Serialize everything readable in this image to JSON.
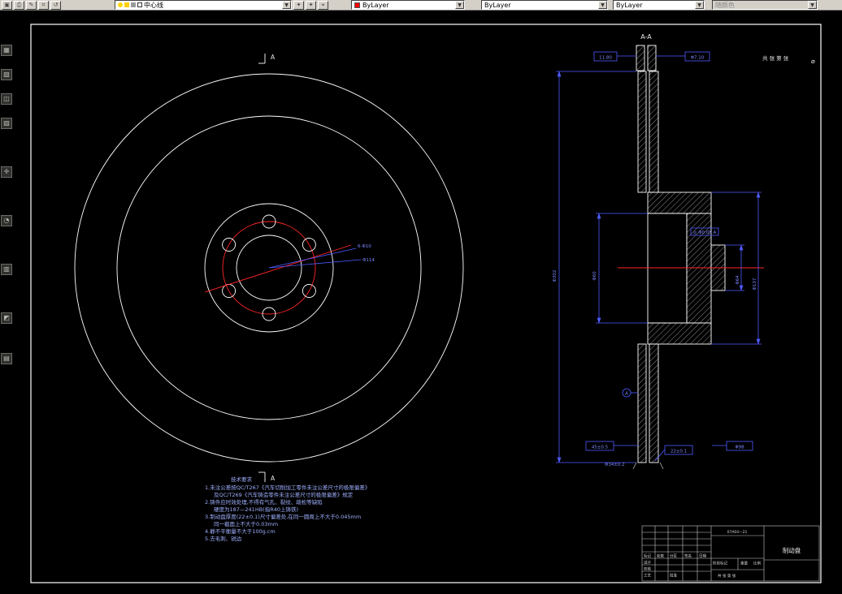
{
  "toolbar": {
    "icons_left": [
      "▣",
      "⎙",
      "✎",
      "⌗",
      "↺"
    ],
    "icons_mid": [
      "✦",
      "✦",
      "⌖"
    ],
    "layer_name": "中心线",
    "color_value": "ByLayer",
    "linetype_value": "ByLayer",
    "lineweight_value": "ByLayer",
    "plot_style_value": "随颜色"
  },
  "icons": {
    "dropdown": "▼"
  },
  "side_tools": [
    "▦",
    "▧",
    "◫",
    "▨",
    "✛",
    "◔",
    "▥",
    "◩",
    "▤"
  ],
  "sheet": {
    "top_note": "共 张 第 张",
    "top_symbol": "⌀"
  },
  "front_view": {
    "cut_label_top": "A",
    "cut_label_bottom": "A",
    "dim_bolt_holes": "6-Φ10",
    "dim_bolt_circle": "Φ114"
  },
  "section_view": {
    "title": "A-A",
    "box_top_left": "11.80",
    "box_top_right": "Φ7.10",
    "dim_overall": "Φ302",
    "dim_bore": "Φ60",
    "dim_pilot": "Φ64",
    "dim_hub": "Φ137",
    "gdt": "◎ Φ0.05 A",
    "box_bottom_1": "45±0.5",
    "box_bottom_2": "22±0.1",
    "box_bottom_3": "Φ98",
    "note_bottom": "Φ34±0.2",
    "datum": "A"
  },
  "tech_requirements": {
    "title": "技术要求",
    "lines": [
      "1.未注公差按QC/T267《汽车切削加工零件未注公差尺寸的极限偏差》",
      "及QC/T269《汽车铸造零件未注公差尺寸的极限偏差》规定",
      "2.铸件应时效处理,不得有气孔、裂纹、疏松等缺陷",
      "硬度为187—241HB(指R40上铸铁)",
      "3.制动盘厚度(22±0.1)尺寸偏差处,在同一圆周上不大于0.045mm",
      "同一截面上不大于0.03mm",
      "4.静不平衡量不大于100g.cm",
      "5.去毛刺、锐边"
    ]
  },
  "title_block": {
    "drawing_no": "07A04—21",
    "part_name": "制动盘",
    "header_cells": [
      "标记",
      "处数",
      "分区",
      "签名",
      "日期"
    ],
    "design_label": "设计",
    "check_label": "校核",
    "process_label": "工艺",
    "approve_label": "批准",
    "stage_label": "阶段标记",
    "weight_label": "重量",
    "scale_label": "比例",
    "sheet_label": "共 张 第 张"
  },
  "colors": {
    "dim_blue": "#4f5bff",
    "geometry_white": "#ffffff",
    "center_red": "#ff2626",
    "toolbar_bg": "#d4d0c8",
    "color_swatch": "#ff0000"
  }
}
